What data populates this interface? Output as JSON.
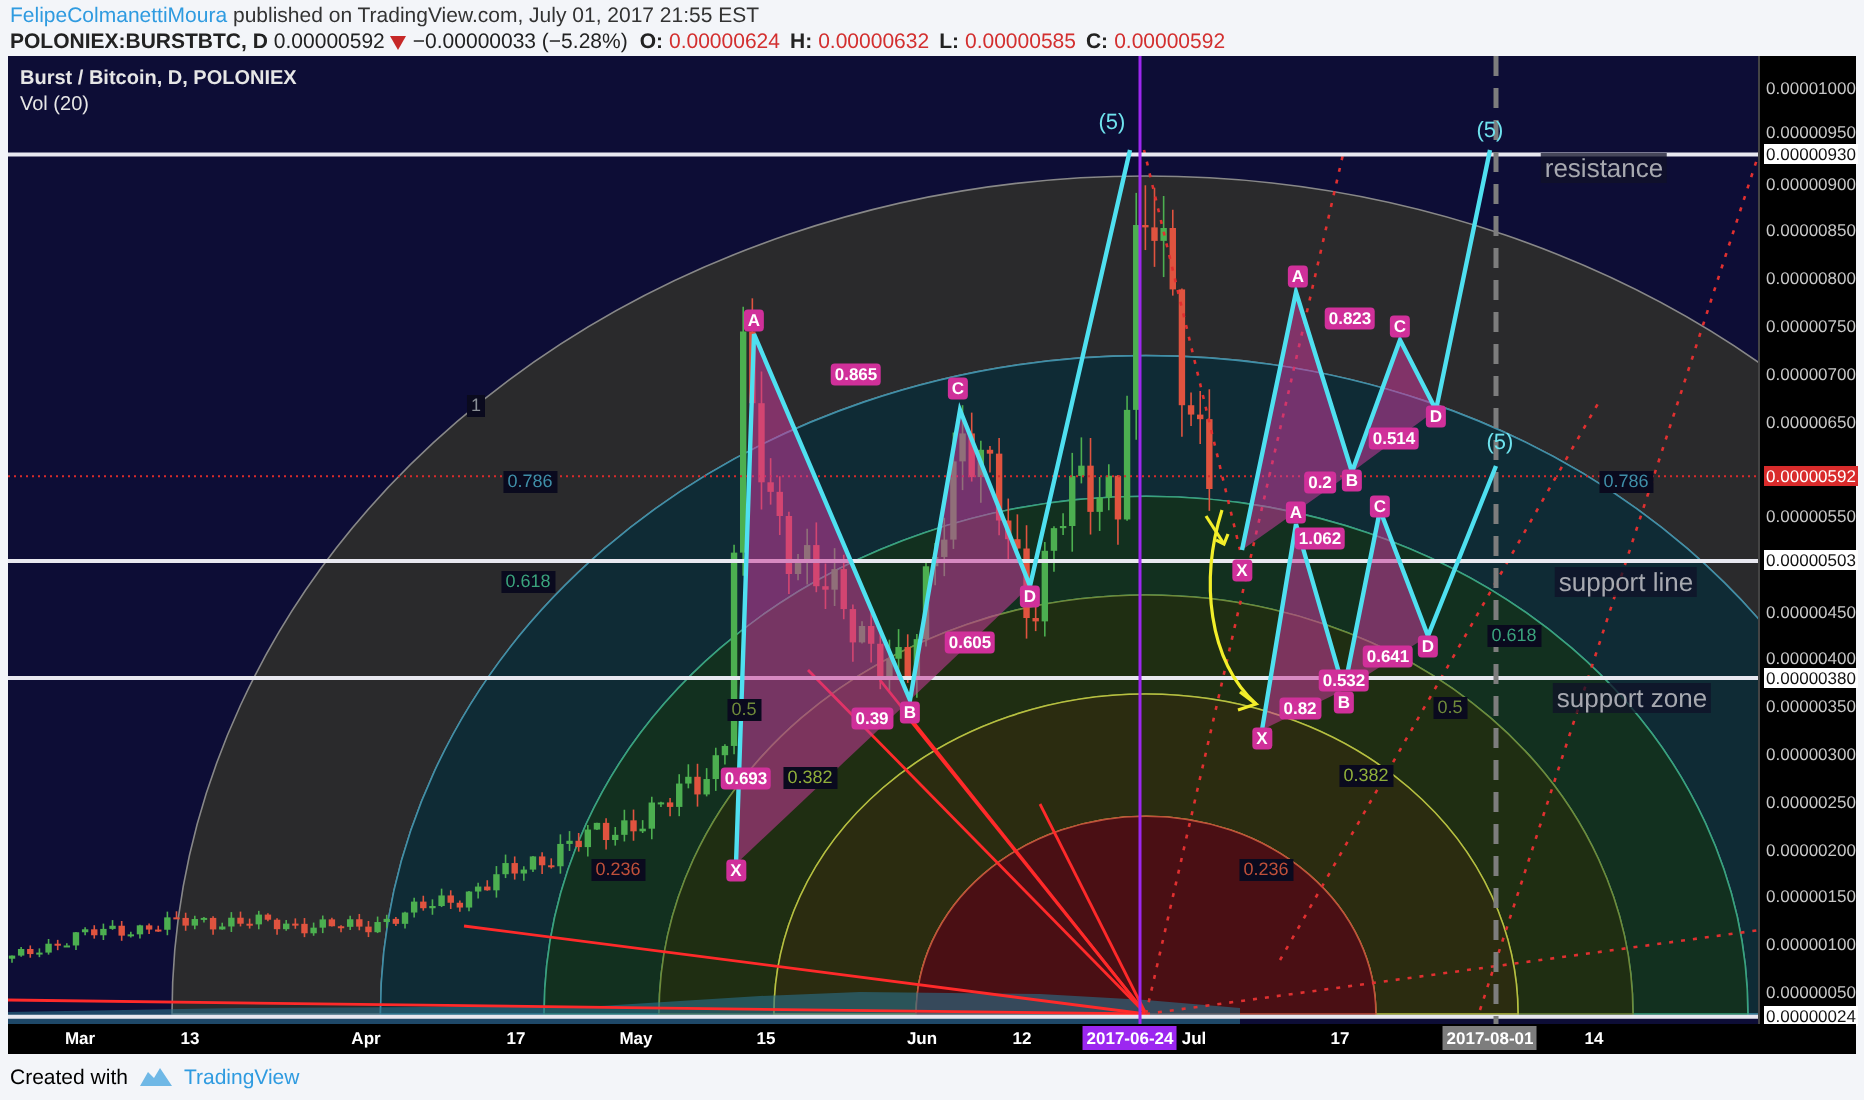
{
  "header": {
    "author": "FelipeColmanettiMoura",
    "published": "published on TradingView.com, July 01, 2017 21:55 EST"
  },
  "quote": {
    "symbol": "POLONIEX:BURSTBTC, D",
    "last": "0.00000592",
    "falling": true,
    "change": "−0.00000033 (−5.28%)",
    "ohlc": [
      {
        "label": "O:",
        "value": "0.00000624"
      },
      {
        "label": "H:",
        "value": "0.00000632"
      },
      {
        "label": "L:",
        "value": "0.00000585"
      },
      {
        "label": "C:",
        "value": "0.00000592"
      }
    ]
  },
  "chart": {
    "legend": [
      "Burst / Bitcoin, D, POLONIEX",
      "Vol (20)"
    ],
    "annotations": [
      {
        "kind": "wave",
        "text": "(5)"
      },
      {
        "kind": "wave",
        "text": "(5)"
      },
      {
        "kind": "note",
        "text": "resistance"
      },
      {
        "kind": "point",
        "text": "A"
      },
      {
        "kind": "point",
        "text": "A"
      },
      {
        "kind": "ratio",
        "text": "0.823"
      },
      {
        "kind": "point",
        "text": "C"
      },
      {
        "kind": "ratio",
        "text": "0.865"
      },
      {
        "kind": "point",
        "text": "C"
      },
      {
        "kind": "fib",
        "text": "1"
      },
      {
        "kind": "point",
        "text": "D"
      },
      {
        "kind": "ratio",
        "text": "0.514"
      },
      {
        "kind": "wave",
        "text": "(5)"
      },
      {
        "kind": "fib",
        "text": "0.786"
      },
      {
        "kind": "ratio",
        "text": "0.2"
      },
      {
        "kind": "point",
        "text": "B"
      },
      {
        "kind": "fib",
        "text": "0.786"
      },
      {
        "kind": "point",
        "text": "A"
      },
      {
        "kind": "point",
        "text": "C"
      },
      {
        "kind": "ratio",
        "text": "1.062"
      },
      {
        "kind": "point",
        "text": "X"
      },
      {
        "kind": "fib",
        "text": "0.618"
      },
      {
        "kind": "point",
        "text": "D"
      },
      {
        "kind": "note",
        "text": "support line"
      },
      {
        "kind": "ratio",
        "text": "0.605"
      },
      {
        "kind": "ratio",
        "text": "0.641"
      },
      {
        "kind": "point",
        "text": "D"
      },
      {
        "kind": "fib",
        "text": "0.618"
      },
      {
        "kind": "ratio",
        "text": "0.532"
      },
      {
        "kind": "fib",
        "text": "0.5"
      },
      {
        "kind": "ratio",
        "text": "0.39"
      },
      {
        "kind": "point",
        "text": "B"
      },
      {
        "kind": "ratio",
        "text": "0.82"
      },
      {
        "kind": "point",
        "text": "B"
      },
      {
        "kind": "fib",
        "text": "0.5"
      },
      {
        "kind": "note",
        "text": "support zone"
      },
      {
        "kind": "point",
        "text": "X"
      },
      {
        "kind": "ratio",
        "text": "0.693"
      },
      {
        "kind": "fib",
        "text": "0.382"
      },
      {
        "kind": "fib",
        "text": "0.382"
      },
      {
        "kind": "fib",
        "text": "0.236"
      },
      {
        "kind": "point",
        "text": "X"
      },
      {
        "kind": "fib",
        "text": "0.236"
      }
    ],
    "price_scale": [
      {
        "kind": "tick",
        "text": "0.00001000"
      },
      {
        "kind": "tick",
        "text": "0.00000950"
      },
      {
        "kind": "line",
        "text": "0.00000930"
      },
      {
        "kind": "tick",
        "text": "0.00000900"
      },
      {
        "kind": "tick",
        "text": "0.00000850"
      },
      {
        "kind": "tick",
        "text": "0.00000800"
      },
      {
        "kind": "tick",
        "text": "0.00000750"
      },
      {
        "kind": "tick",
        "text": "0.00000700"
      },
      {
        "kind": "tick",
        "text": "0.00000650"
      },
      {
        "kind": "last",
        "text": "0.00000592"
      },
      {
        "kind": "tick",
        "text": "0.00000550"
      },
      {
        "kind": "line",
        "text": "0.00000503"
      },
      {
        "kind": "tick",
        "text": "0.00000450"
      },
      {
        "kind": "tick",
        "text": "0.00000400"
      },
      {
        "kind": "line",
        "text": "0.00000380"
      },
      {
        "kind": "tick",
        "text": "0.00000350"
      },
      {
        "kind": "tick",
        "text": "0.00000300"
      },
      {
        "kind": "tick",
        "text": "0.00000250"
      },
      {
        "kind": "tick",
        "text": "0.00000200"
      },
      {
        "kind": "tick",
        "text": "0.00000150"
      },
      {
        "kind": "tick",
        "text": "0.00000100"
      },
      {
        "kind": "tick",
        "text": "0.00000050"
      },
      {
        "kind": "line",
        "text": "0.00000024"
      }
    ],
    "time_scale": [
      {
        "kind": "tick",
        "text": "Mar"
      },
      {
        "kind": "tick",
        "text": "13"
      },
      {
        "kind": "tick",
        "text": "Apr"
      },
      {
        "kind": "tick",
        "text": "17"
      },
      {
        "kind": "tick",
        "text": "May"
      },
      {
        "kind": "tick",
        "text": "15"
      },
      {
        "kind": "tick",
        "text": "Jun"
      },
      {
        "kind": "tick",
        "text": "12"
      },
      {
        "kind": "badge",
        "text": "2017-06-24",
        "color": "#9c27f0"
      },
      {
        "kind": "tick",
        "text": "Jul"
      },
      {
        "kind": "tick",
        "text": "17"
      },
      {
        "kind": "badge",
        "text": "2017-08-01",
        "color": "#7d7d7d"
      },
      {
        "kind": "tick",
        "text": "14"
      }
    ]
  },
  "footer": {
    "text": "Created with",
    "brand": "TradingView"
  }
}
